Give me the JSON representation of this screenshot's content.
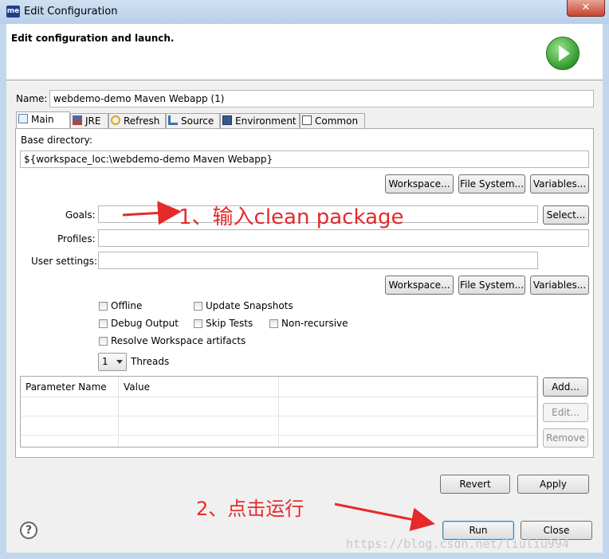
{
  "window": {
    "app_icon_text": "me",
    "title": "Edit Configuration",
    "close_glyph": "✕"
  },
  "header": {
    "title": "Edit configuration and launch.",
    "logo_icon": "run-launch-icon"
  },
  "name_field": {
    "label": "Name:",
    "value": "webdemo-demo Maven Webapp (1)"
  },
  "tabs": [
    {
      "label": "Main",
      "icon": "main-tab-icon",
      "active": true
    },
    {
      "label": "JRE",
      "icon": "jre-icon"
    },
    {
      "label": "Refresh",
      "icon": "refresh-icon"
    },
    {
      "label": "Source",
      "icon": "source-icon"
    },
    {
      "label": "Environment",
      "icon": "environment-icon"
    },
    {
      "label": "Common",
      "icon": "common-icon"
    }
  ],
  "main": {
    "base_dir_label": "Base directory:",
    "base_dir_value": "${workspace_loc:\\webdemo-demo Maven Webapp}",
    "btn_workspace": "Workspace...",
    "btn_filesystem": "File System...",
    "btn_variables": "Variables...",
    "goals_label": "Goals:",
    "goals_value": "",
    "btn_select": "Select...",
    "profiles_label": "Profiles:",
    "profiles_value": "",
    "user_settings_label": "User settings:",
    "user_settings_value": "",
    "checkboxes": {
      "offline": "Offline",
      "update_snapshots": "Update Snapshots",
      "debug_output": "Debug Output",
      "skip_tests": "Skip Tests",
      "non_recursive": "Non-recursive",
      "resolve_workspace": "Resolve Workspace artifacts"
    },
    "threads_value": "1",
    "threads_label": "Threads",
    "table": {
      "columns": [
        "Parameter Name",
        "Value",
        ""
      ],
      "rows": []
    },
    "btn_add": "Add...",
    "btn_edit": "Edit...",
    "btn_remove": "Remove"
  },
  "footer": {
    "revert": "Revert",
    "apply": "Apply",
    "run": "Run",
    "close": "Close",
    "help_glyph": "?"
  },
  "annotations": {
    "step1": "1、输入clean package",
    "step2": "2、点击运行"
  },
  "watermark": "https://blog.csdn.net/liuliu994",
  "colors": {
    "annotation_red": "#e8292b",
    "run_green": "#2f9a2c"
  }
}
